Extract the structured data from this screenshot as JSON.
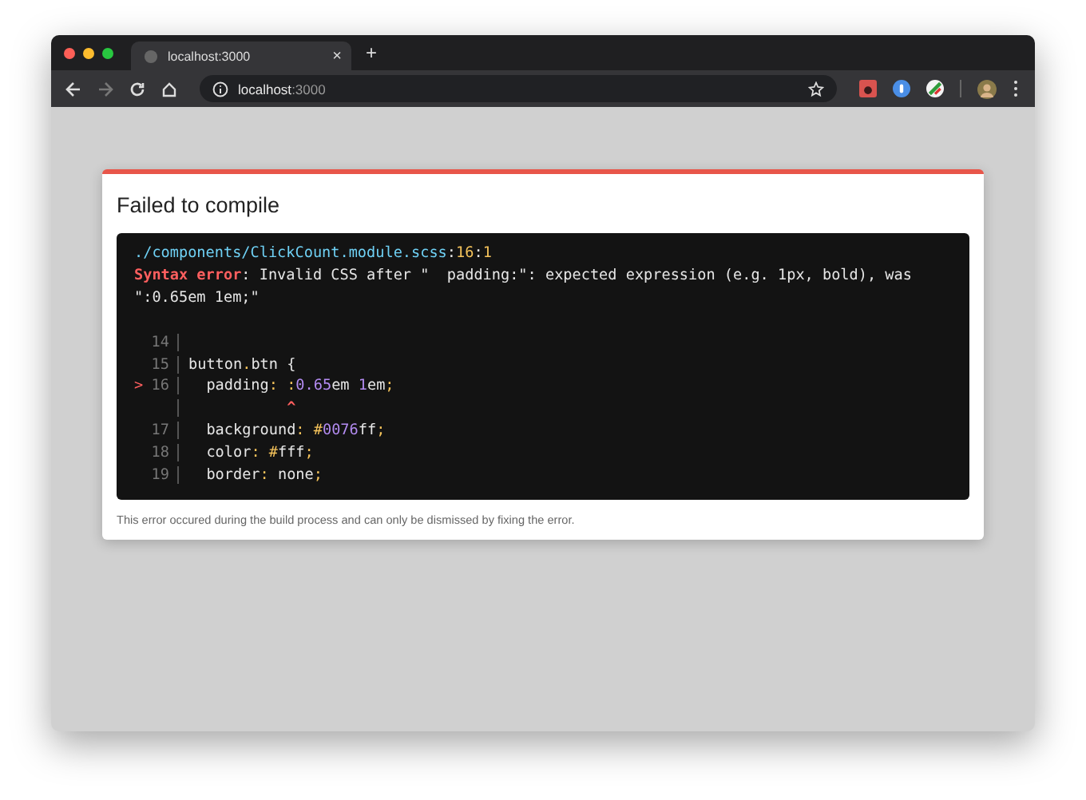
{
  "browser": {
    "tab": {
      "title": "localhost:3000",
      "close": "×",
      "selected": true
    },
    "new_tab": "+",
    "address": {
      "host": "localhost",
      "port": ":3000"
    }
  },
  "error": {
    "title": "Failed to compile",
    "location": [
      {
        "kind": "path",
        "text": "./components/ClickCount.module.scss"
      },
      {
        "kind": "text",
        "text": ":"
      },
      {
        "kind": "loc",
        "text": "16"
      },
      {
        "kind": "text",
        "text": ":"
      },
      {
        "kind": "loc",
        "text": "1"
      }
    ],
    "message": [
      {
        "kind": "error",
        "text": "Syntax error"
      },
      {
        "kind": "text",
        "text": ": Invalid CSS after \"  padding:\": expected expression (e.g. 1px, bold), was \":0.65em 1em;\""
      }
    ],
    "lines": [
      {
        "number": "14"
      },
      {
        "number": "15",
        "tokens": [
          {
            "kind": "text",
            "text": "button"
          },
          {
            "kind": "punct",
            "text": "."
          },
          {
            "kind": "text",
            "text": "btn {"
          }
        ]
      },
      {
        "number": "16",
        "pointer": ">",
        "tokens": [
          {
            "kind": "text",
            "text": "  padding"
          },
          {
            "kind": "punct",
            "text": ": :"
          },
          {
            "kind": "num",
            "text": "0.65"
          },
          {
            "kind": "text",
            "text": "em "
          },
          {
            "kind": "num",
            "text": "1"
          },
          {
            "kind": "text",
            "text": "em"
          },
          {
            "kind": "punct",
            "text": ";"
          }
        ]
      },
      {
        "tokens": [
          {
            "kind": "error",
            "text": "           ^"
          }
        ]
      },
      {
        "number": "17",
        "tokens": [
          {
            "kind": "text",
            "text": "  background"
          },
          {
            "kind": "punct",
            "text": ": #"
          },
          {
            "kind": "num",
            "text": "0076"
          },
          {
            "kind": "text",
            "text": "ff"
          },
          {
            "kind": "punct",
            "text": ";"
          }
        ]
      },
      {
        "number": "18",
        "tokens": [
          {
            "kind": "text",
            "text": "  color"
          },
          {
            "kind": "punct",
            "text": ": #"
          },
          {
            "kind": "text",
            "text": "fff"
          },
          {
            "kind": "punct",
            "text": ";"
          }
        ]
      },
      {
        "number": "19",
        "tokens": [
          {
            "kind": "text",
            "text": "  border"
          },
          {
            "kind": "punct",
            "text": ":"
          },
          {
            "kind": "text",
            "text": " none"
          },
          {
            "kind": "punct",
            "text": ";"
          }
        ]
      }
    ],
    "footer": "This error occured during the build process and can only be dismissed by fixing the error."
  }
}
